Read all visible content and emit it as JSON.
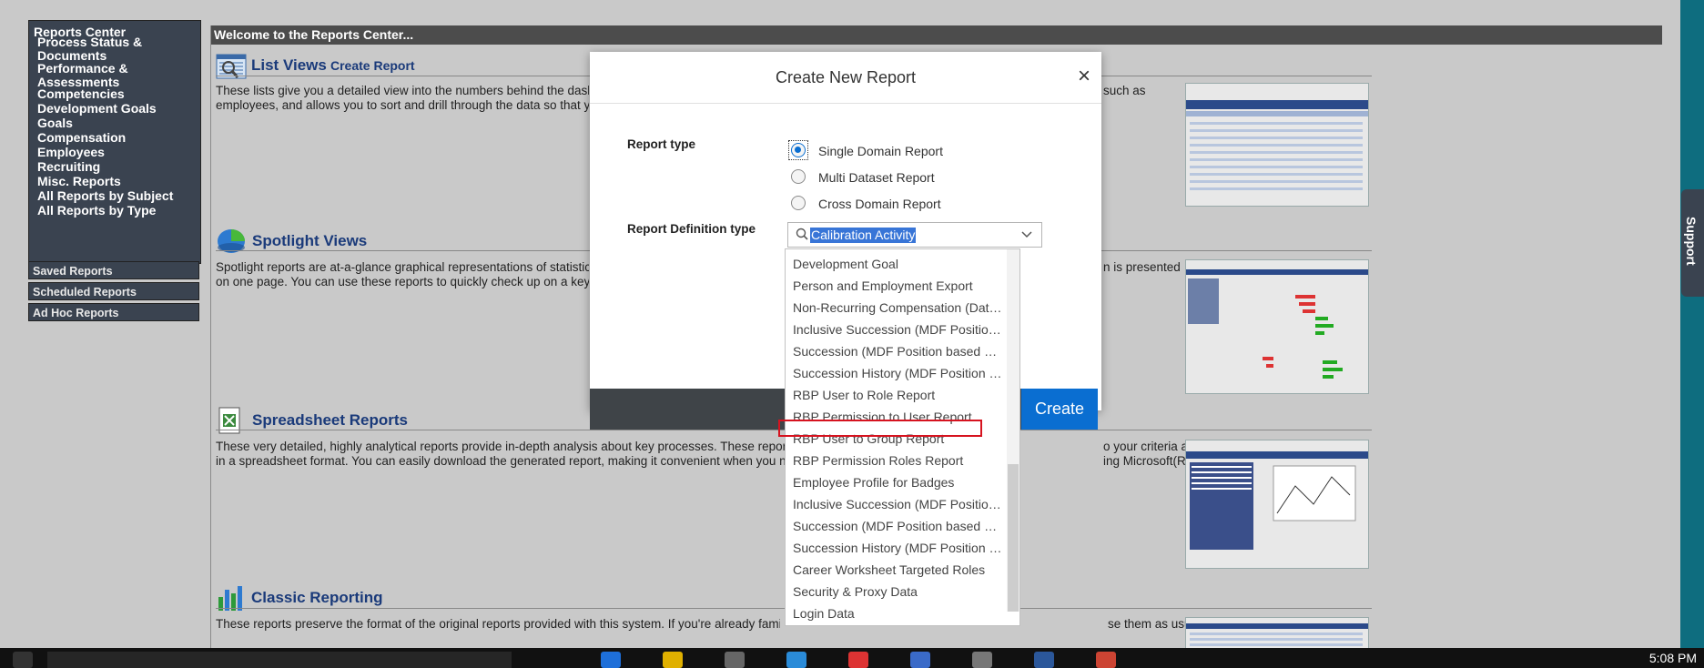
{
  "sidebar": {
    "header": "Reports Center",
    "items": [
      "Process Status & Documents",
      "Performance & Assessments",
      "Competencies",
      "Development Goals",
      "Goals",
      "Compensation",
      "Employees",
      "Recruiting",
      "Misc. Reports",
      "All Reports by Subject",
      "All Reports by Type"
    ],
    "sections": [
      "Saved Reports",
      "Scheduled Reports",
      "Ad Hoc Reports"
    ]
  },
  "content": {
    "welcome": "Welcome to the Reports Center...",
    "sections": [
      {
        "title": "List Views",
        "link": "Create Report",
        "desc1": "These lists give you a detailed view into the numbers behind the dash",
        "desc1b": "such as",
        "desc2": "employees, and allows you to sort and drill through the data so that y"
      },
      {
        "title": "Spotlight Views",
        "desc1": "Spotlight reports are at-a-glance graphical representations of statistic",
        "desc1b": "n is presented",
        "desc2": "on one page. You can use these reports to quickly check up on a key"
      },
      {
        "title": "Spreadsheet Reports",
        "desc1": "These very detailed, highly analytical reports provide in-depth analysis about key processes. These repor",
        "desc1b": "o your criteria and presented",
        "desc2": "in a spreadsheet format. You can easily download the generated report, making it convenient when you n",
        "desc2b": "ing Microsoft(R) Excel(TM)."
      },
      {
        "title": "Classic Reporting",
        "desc1": "These reports preserve the format of the original reports provided with this system. If you're already famil",
        "desc1b": "se them as usual."
      }
    ]
  },
  "dialog": {
    "title": "Create New Report",
    "close": "×",
    "report_type_label": "Report type",
    "report_types": [
      "Single Domain Report",
      "Multi Dataset Report",
      "Cross Domain Report"
    ],
    "selected_report_type": "Single Domain Report",
    "definition_label": "Report Definition type",
    "definition_value": "Calibration Activity",
    "create": "Create",
    "options": [
      "Development Goal",
      "Person and Employment Export",
      "Non-Recurring Compensation (Date…",
      "Inclusive Succession (MDF Position…",
      "Succession (MDF Position based n…",
      "Succession History (MDF Position b…",
      "RBP User to Role Report",
      "RBP Permission to User Report",
      "RBP User to Group Report",
      "RBP Permission Roles Report",
      "Employee Profile for Badges",
      "Inclusive Succession (MDF Position…",
      "Succession (MDF Position based n…",
      "Succession History (MDF Position b…",
      "Career Worksheet Targeted Roles",
      "Security & Proxy Data",
      "Login Data"
    ],
    "highlighted_option": "RBP User to Group Report"
  },
  "support_tab": "Support",
  "taskbar": {
    "clock": "5:08 PM"
  },
  "colors": {
    "accent": "#0a6ed1",
    "nav_bg": "#3a4350",
    "highlight": "#d6131f"
  }
}
